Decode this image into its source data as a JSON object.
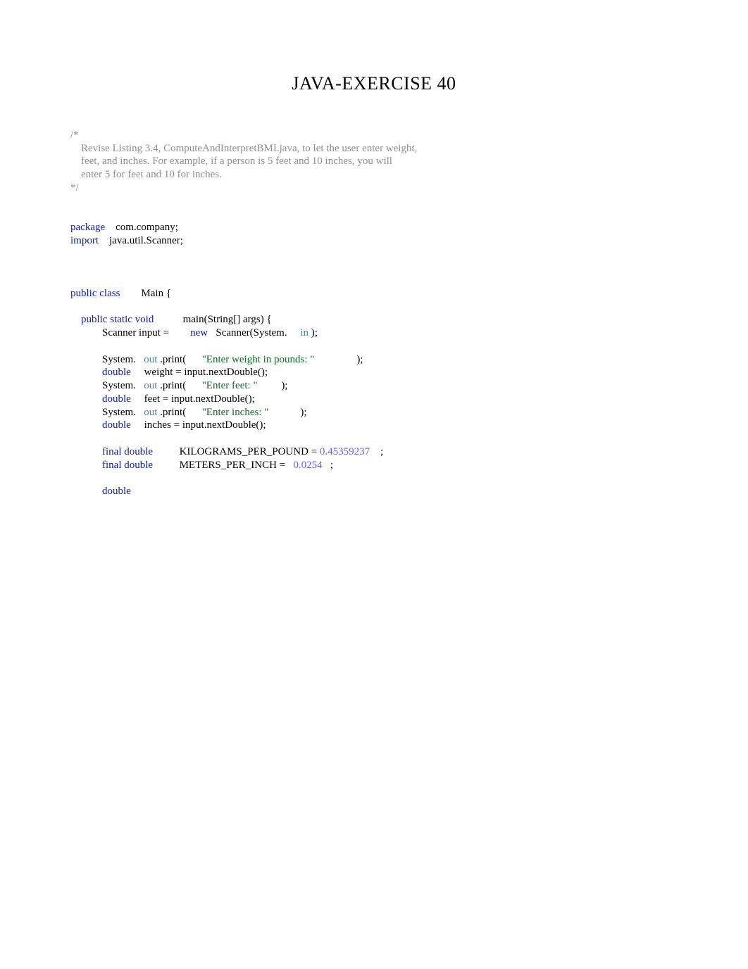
{
  "title": "JAVA-EXERCISE 40",
  "comment": {
    "open": "/*",
    "line1": "    Revise Listing 3.4, ComputeAndInterpretBMI.java, to let the user enter weight,",
    "line2": "    feet, and inches. For example, if a person is 5 feet and 10 inches, you will",
    "line3": "    enter 5 for feet and 10 for inches.",
    "close": "*/"
  },
  "pkg": {
    "kw": "package",
    "name": "    com.company;"
  },
  "imp": {
    "kw": "import",
    "name": "    java.util.Scanner;"
  },
  "cls": {
    "kw": "public class",
    "name": "        Main {"
  },
  "method": {
    "kw": "public static void",
    "sig": "           main(String[] args) {"
  },
  "scanner": {
    "pre": "Scanner input = ",
    "new": "       new",
    "rest": "   Scanner(System.",
    "in": "     in",
    "end": " );"
  },
  "l1": {
    "sys": "System.",
    "out": "   out",
    "print": " .print(",
    "str": "      \"Enter weight in pounds: \"",
    "end": "                );"
  },
  "l2": {
    "kw": "double",
    "rest": "     weight = input.nextDouble();"
  },
  "l3": {
    "sys": "System.",
    "out": "   out",
    "print": " .print(",
    "str": "      \"Enter feet: \"",
    "end": "         );"
  },
  "l4": {
    "kw": "double",
    "rest": "     feet = input.nextDouble();"
  },
  "l5": {
    "sys": "System.",
    "out": "   out",
    "print": " .print(",
    "str": "      \"Enter inches: \"",
    "end": "            );"
  },
  "l6": {
    "kw": "double",
    "rest": "     inches = input.nextDouble();"
  },
  "c1": {
    "kw": "final double",
    "name": "          KILOGRAMS_PER_POUND = ",
    "num": "0.45359237",
    "end": "    ;"
  },
  "c2": {
    "kw": "final double",
    "name": "          METERS_PER_INCH = ",
    "num": "  0.0254",
    "end": "   ;"
  },
  "last": {
    "kw": "double"
  }
}
